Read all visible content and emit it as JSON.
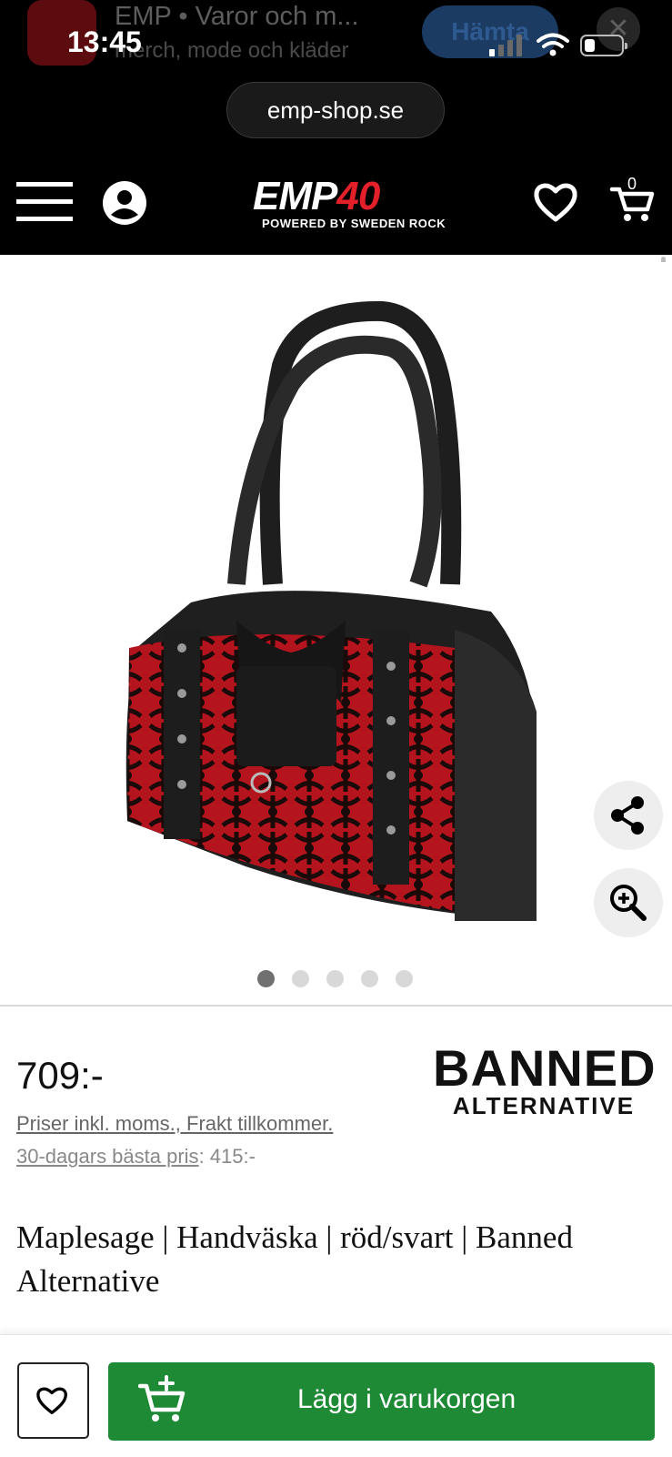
{
  "app_banner": {
    "title": "EMP • Varor och m...",
    "subtitle": "merch, mode och kläder",
    "get_label": "Hämta",
    "close_label": "✕"
  },
  "status_bar": {
    "time": "13:45",
    "battery_level": 0.3
  },
  "browser": {
    "url": "emp-shop.se"
  },
  "header": {
    "logo_main": "EMP",
    "logo_number": "40",
    "logo_sub": "POWERED BY SWEDEN ROCK",
    "cart_count": "0"
  },
  "gallery": {
    "image_count": 5,
    "active_index": 0,
    "share_icon": "share-icon",
    "zoom_icon": "zoom-in-icon"
  },
  "product": {
    "price": "709:-",
    "vat_note": "Priser inkl. moms., Frakt tillkommer.",
    "best_price_link": "30-dagars bästa pris",
    "best_price_value": ": 415:-",
    "brand_line1": "BANNED",
    "brand_line2": "ALTERNATIVE",
    "name": "Maplesage | Handväska | röd/svart | Banned Alternative"
  },
  "actions": {
    "add_to_cart": "Lägg i varukorgen"
  },
  "colors": {
    "accent_green": "#1f8a35",
    "brand_red": "#e3202a",
    "header_bg": "#000000"
  }
}
